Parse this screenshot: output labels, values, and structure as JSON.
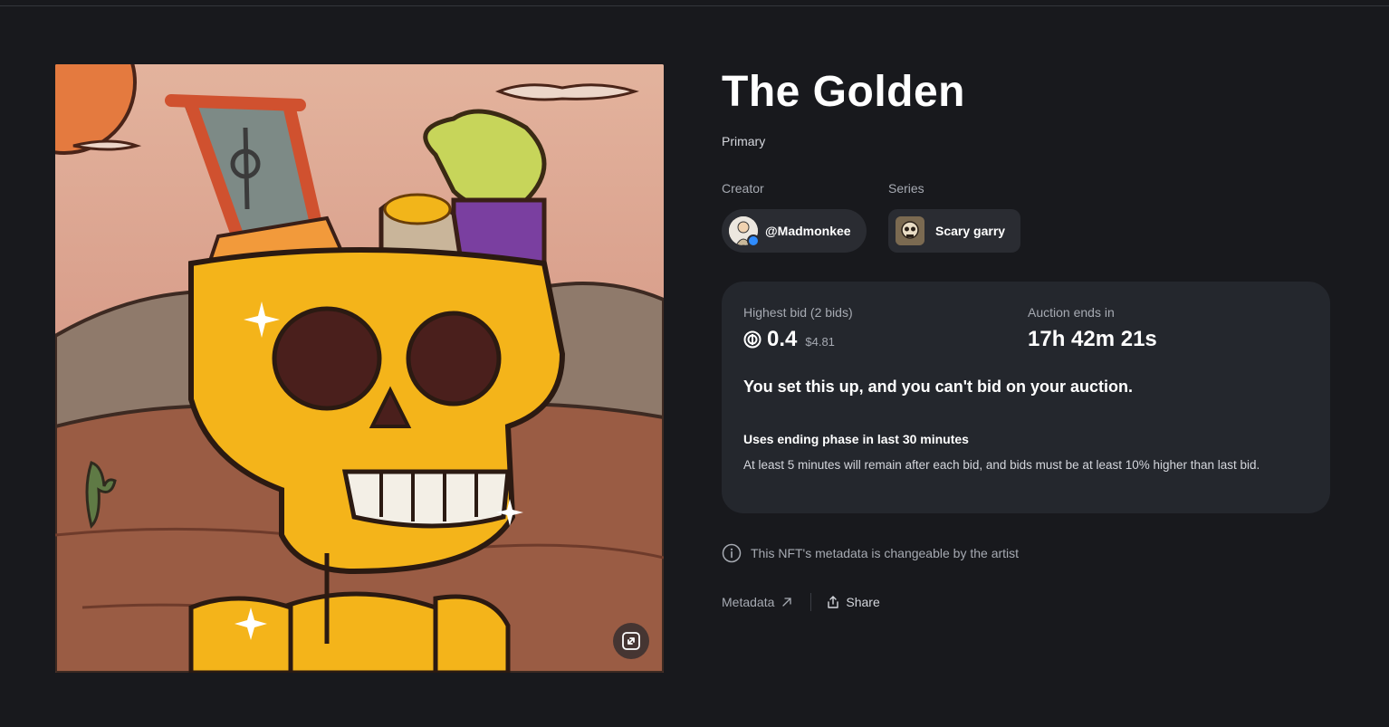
{
  "nft": {
    "title": "The Golden",
    "sale_type": "Primary",
    "artwork_alt": "Golden skull illustration in desert",
    "expand_icon": "expand-icon"
  },
  "creator": {
    "label": "Creator",
    "handle": "@Madmonkee",
    "verified_icon": "twitter-verified-icon"
  },
  "series": {
    "label": "Series",
    "name": "Scary garry"
  },
  "auction": {
    "bid_label": "Highest bid (2 bids)",
    "bid_value": "0.4",
    "bid_usd": "$4.81",
    "currency_icon": "tezos-icon",
    "ends_label": "Auction ends in",
    "countdown": "17h 42m 21s",
    "notice": "You set this up, and you can't bid on your auction.",
    "phase_title": "Uses ending phase in last 30 minutes",
    "phase_desc": "At least 5 minutes will remain after each bid, and bids must be at least 10% higher than last bid."
  },
  "metadata_note": "This NFT's metadata is changeable by the artist",
  "links": {
    "metadata": "Metadata",
    "share": "Share"
  },
  "colors": {
    "background": "#18191d",
    "panel": "#24272d",
    "chip": "#2a2c32",
    "muted_text": "#a6aab2"
  }
}
